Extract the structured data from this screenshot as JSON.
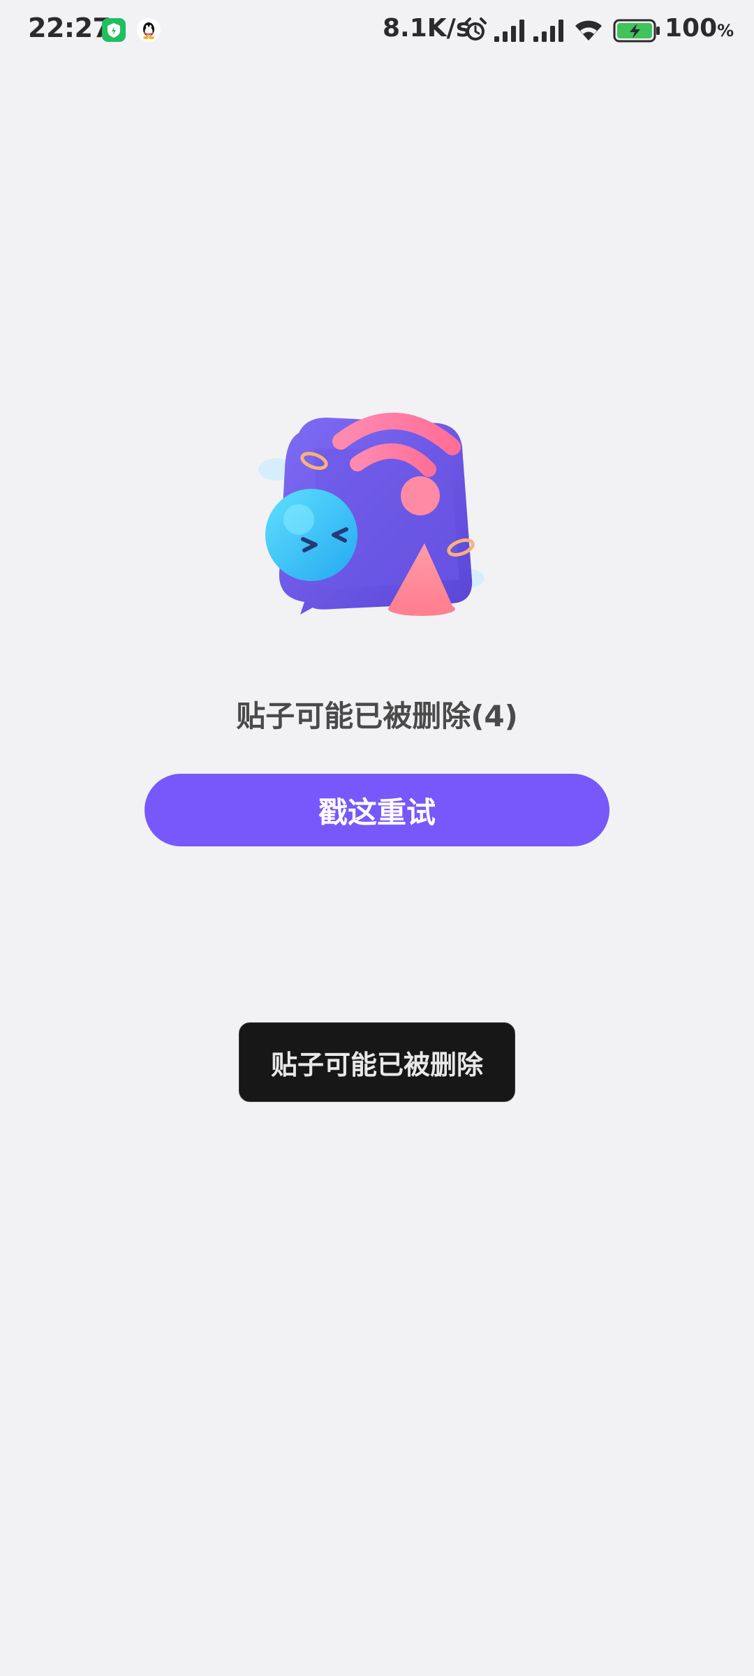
{
  "status_bar": {
    "time": "22:27",
    "network_speed": "8.1K/s",
    "battery_percent": "100",
    "battery_unit": "%",
    "notification_icons": [
      "shield-app-icon",
      "qq-penguin-icon"
    ],
    "status_icons": [
      "alarm-icon",
      "signal-bars-icon",
      "signal-bars-icon",
      "wifi-icon",
      "battery-charging-icon"
    ]
  },
  "error_state": {
    "illustration": "broken-connection-illustration",
    "message": "贴子可能已被删除(4)",
    "retry_label": "戳这重试"
  },
  "toast": {
    "text": "贴子可能已被删除"
  },
  "colors": {
    "background": "#f2f2f5",
    "accent": "#7758fb",
    "toast_bg": "#171717",
    "battery": "#3fc35a"
  }
}
